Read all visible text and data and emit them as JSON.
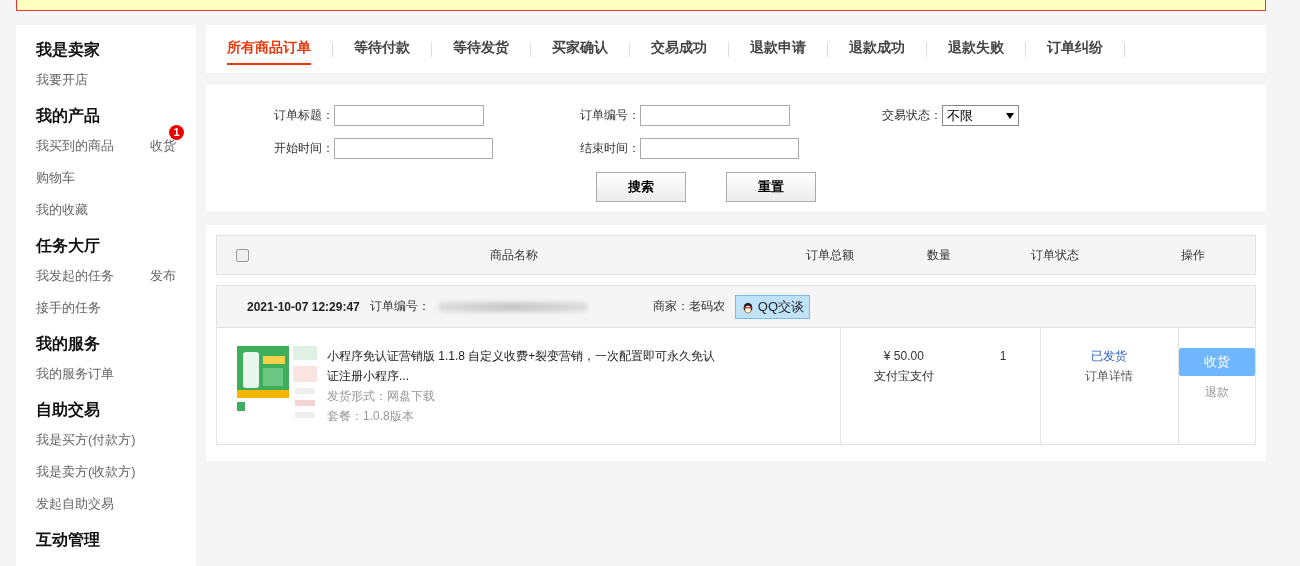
{
  "sidebar": {
    "groups": [
      {
        "title": "我是卖家",
        "items": [
          {
            "label": "我要开店"
          }
        ]
      },
      {
        "title": "我的产品",
        "items": [
          {
            "label": "我买到的商品",
            "action": "收货",
            "badge": "1"
          },
          {
            "label": "购物车"
          },
          {
            "label": "我的收藏"
          }
        ]
      },
      {
        "title": "任务大厅",
        "items": [
          {
            "label": "我发起的任务",
            "action": "发布"
          },
          {
            "label": "接手的任务"
          }
        ]
      },
      {
        "title": "我的服务",
        "items": [
          {
            "label": "我的服务订单"
          }
        ]
      },
      {
        "title": "自助交易",
        "items": [
          {
            "label": "我是买方(付款方)"
          },
          {
            "label": "我是卖方(收款方)"
          },
          {
            "label": "发起自助交易"
          }
        ]
      },
      {
        "title": "互动管理"
      }
    ]
  },
  "tabs": [
    {
      "label": "所有商品订单",
      "selected": true
    },
    {
      "label": "等待付款",
      "selected": false
    },
    {
      "label": "等待发货",
      "selected": false
    },
    {
      "label": "买家确认",
      "selected": false
    },
    {
      "label": "交易成功",
      "selected": false
    },
    {
      "label": "退款申请",
      "selected": false
    },
    {
      "label": "退款成功",
      "selected": false
    },
    {
      "label": "退款失败",
      "selected": false
    },
    {
      "label": "订单纠纷",
      "selected": false
    }
  ],
  "search": {
    "fields": [
      {
        "label": "订单标题：",
        "kind": "text"
      },
      {
        "label": "订单编号：",
        "kind": "text"
      },
      {
        "label": "交易状态：",
        "kind": "select",
        "value": "不限"
      },
      {
        "label": "开始时间：",
        "kind": "text"
      },
      {
        "label": "结束时间：",
        "kind": "text"
      }
    ],
    "buttons": [
      "搜索",
      "重置"
    ]
  },
  "table": {
    "select_all": {
      "checked": false
    },
    "columns": [
      "商品名称",
      "订单总额",
      "数量",
      "订单状态",
      "操作"
    ],
    "orders": [
      {
        "time": "2021-10-07 12:29:47",
        "order_no_label": "订单编号：",
        "merchant": "商家：老码农",
        "chat": "QQ交谈",
        "product": {
          "title": "小程序免认证营销版 1.1.8 自定义收费+裂变营销，一次配置即可永久免认证注册小程序...",
          "delivery": "发货形式：网盘下载",
          "package": "套餐：1.0.8版本"
        },
        "total": "¥ 50.00",
        "payment": "支付宝支付",
        "quantity": "1",
        "status": "已发货",
        "detail": "订单详情",
        "action": "收货",
        "refund": "退款"
      }
    ]
  }
}
